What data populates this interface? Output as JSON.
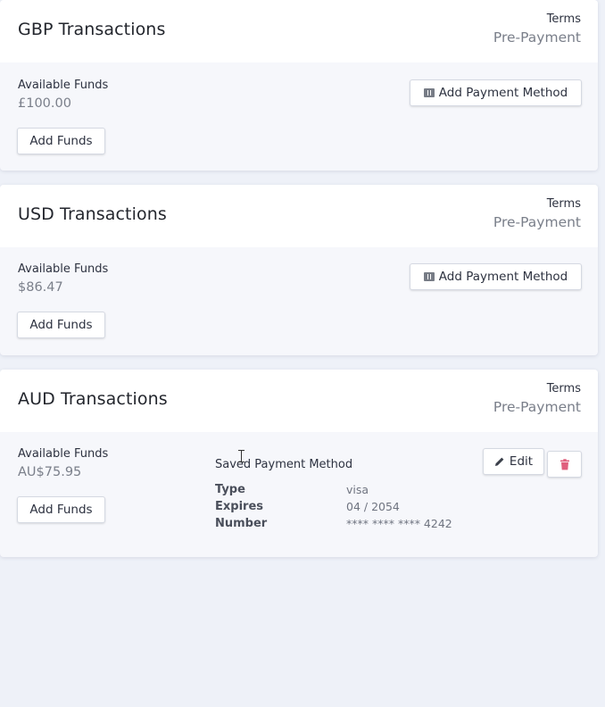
{
  "cards": [
    {
      "title": "GBP Transactions",
      "terms_label": "Terms",
      "terms_value": "Pre-Payment",
      "funds_label": "Available Funds",
      "funds_value": "£100.00",
      "add_funds_label": "Add Funds",
      "add_payment_method_label": "Add Payment Method"
    },
    {
      "title": "USD Transactions",
      "terms_label": "Terms",
      "terms_value": "Pre-Payment",
      "funds_label": "Available Funds",
      "funds_value": "$86.47",
      "add_funds_label": "Add Funds",
      "add_payment_method_label": "Add Payment Method"
    },
    {
      "title": "AUD Transactions",
      "terms_label": "Terms",
      "terms_value": "Pre-Payment",
      "funds_label": "Available Funds",
      "funds_value": "AU$75.95",
      "add_funds_label": "Add Funds",
      "saved_method": {
        "title": "Saved Payment Method",
        "type_label": "Type",
        "type_value": "visa",
        "expires_label": "Expires",
        "expires_value": "04 / 2054",
        "number_label": "Number",
        "number_value": "**** **** **** 4242",
        "edit_label": "Edit"
      }
    }
  ],
  "icons": {
    "add_method": "credit-card-plus-icon",
    "edit": "pencil-icon",
    "delete": "trash-icon"
  },
  "colors": {
    "page_bg": "#eef1f8",
    "card_header": "#ffffff",
    "card_body": "#f6f7fb",
    "delete_icon": "#e0607e"
  }
}
